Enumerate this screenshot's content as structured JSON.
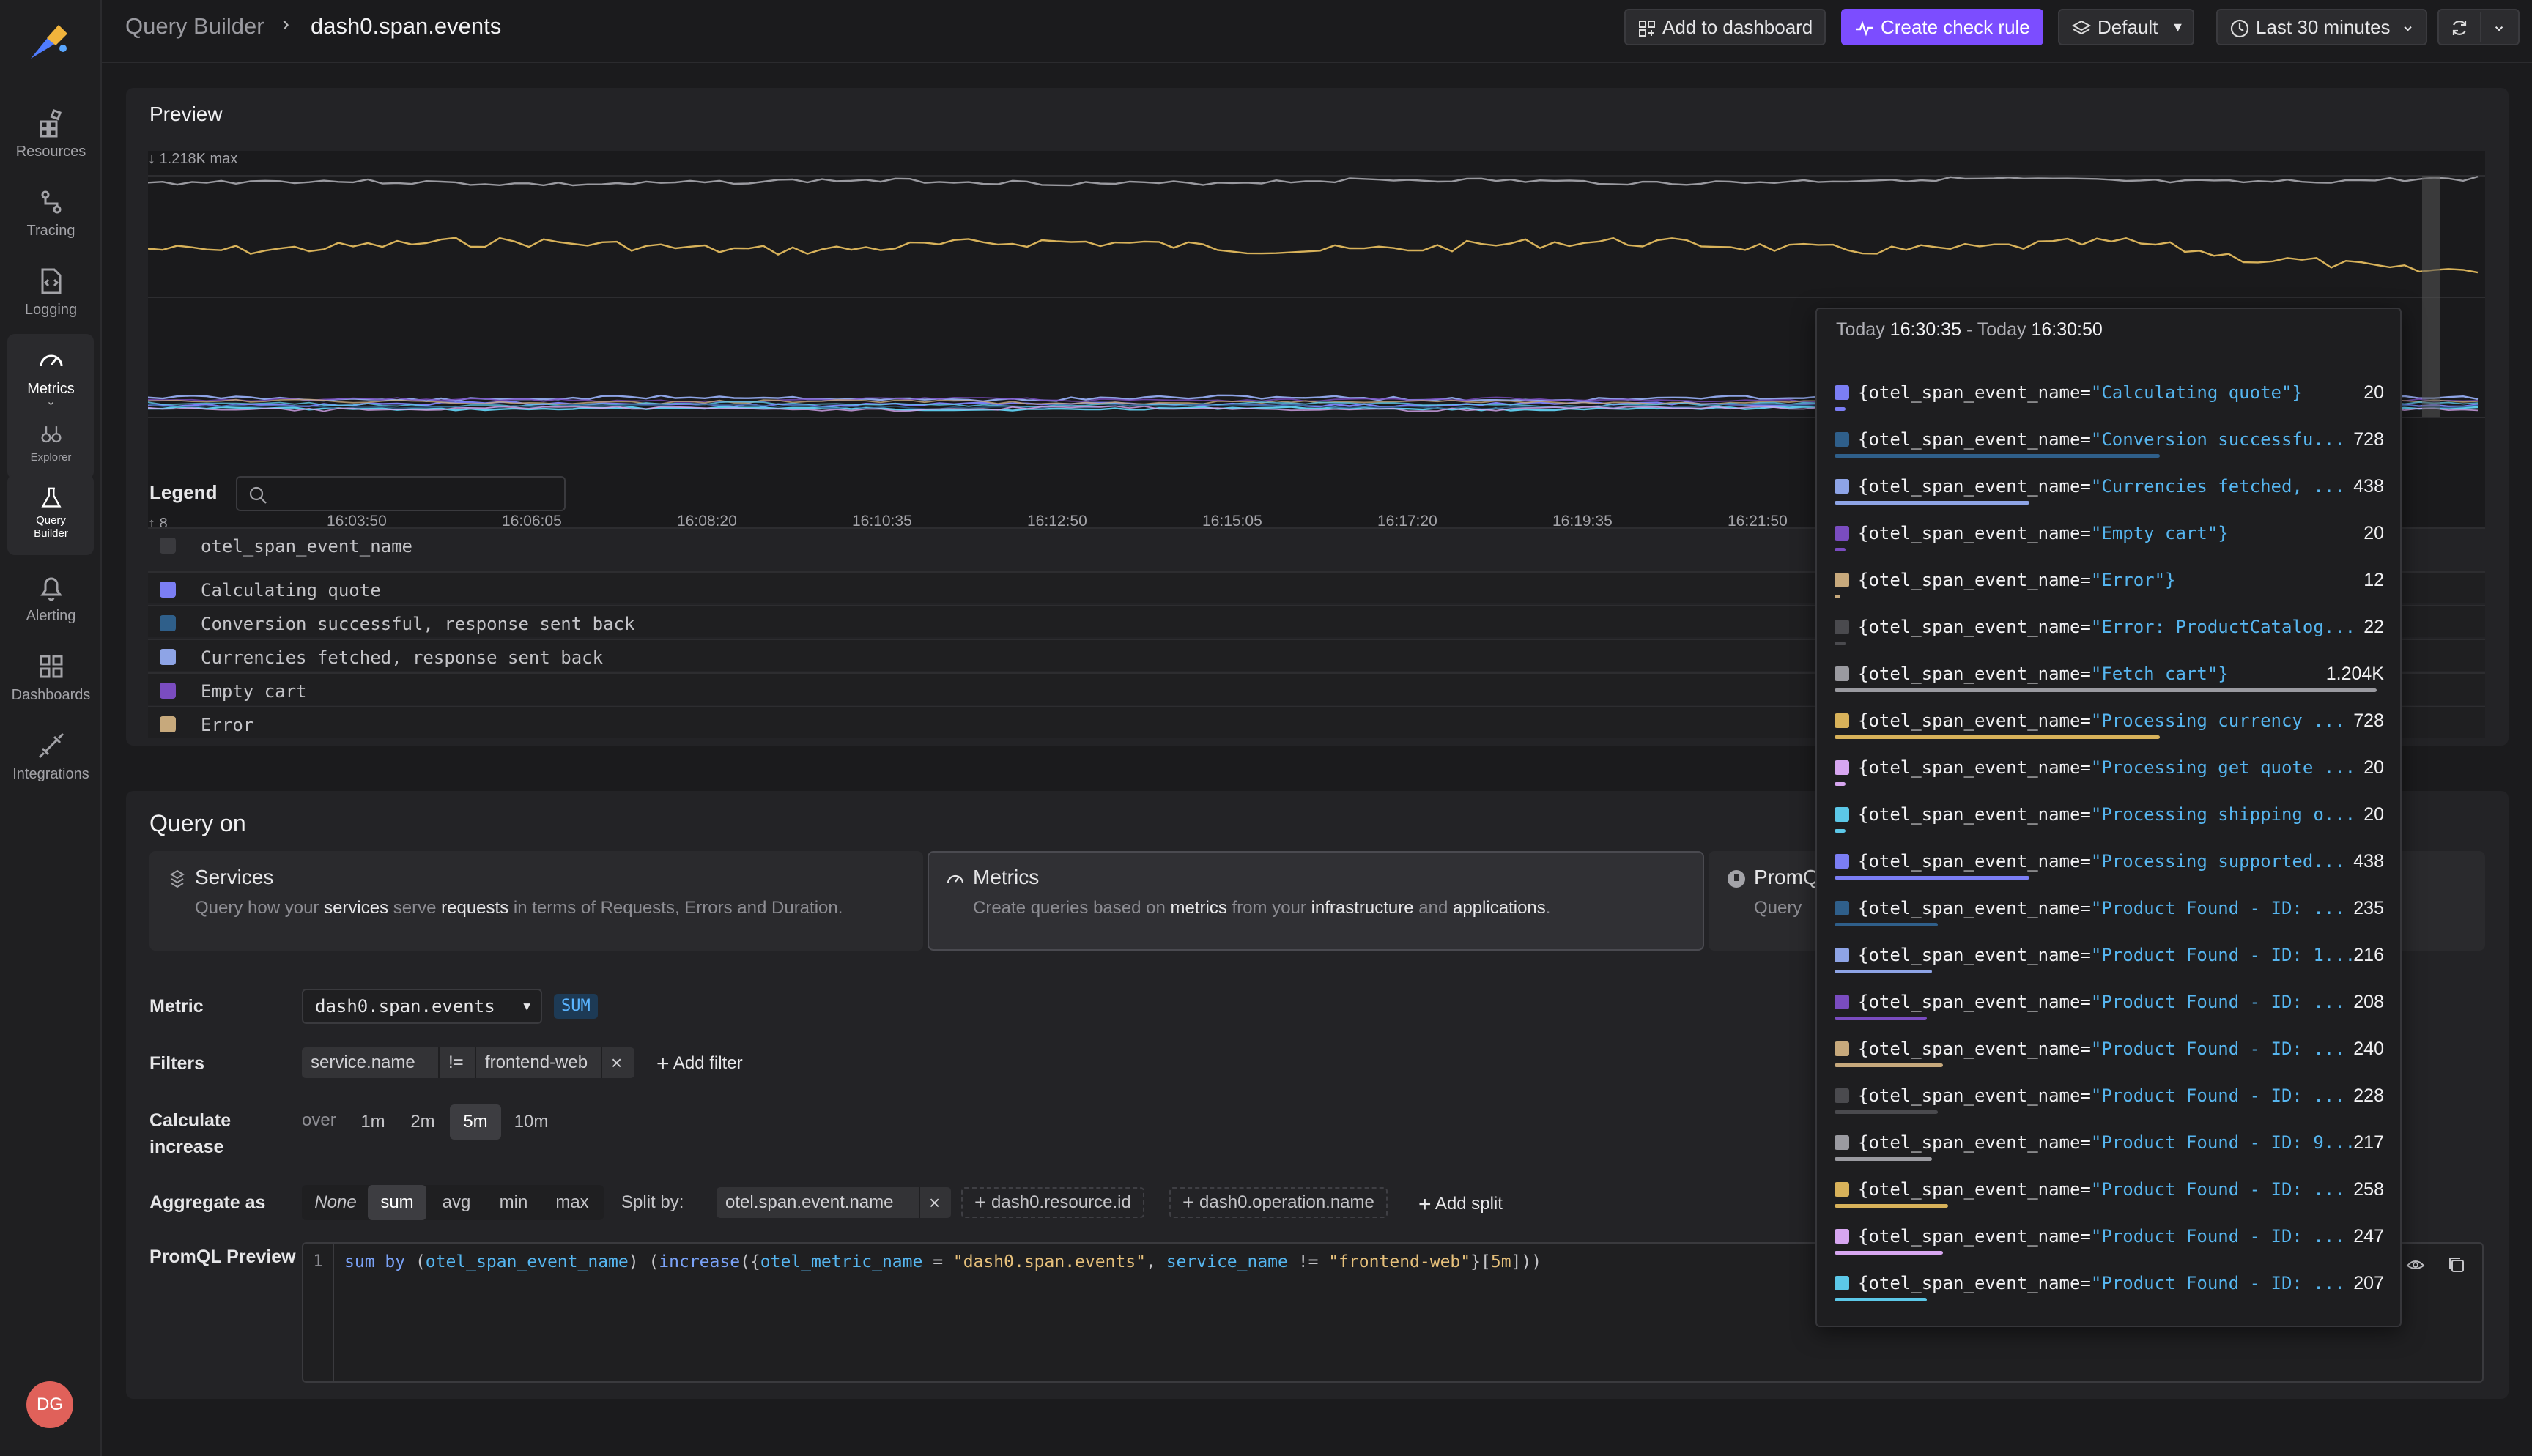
{
  "sidebar": {
    "items": [
      {
        "label": "Resources",
        "icon": "resources-icon"
      },
      {
        "label": "Tracing",
        "icon": "tracing-icon"
      },
      {
        "label": "Logging",
        "icon": "logging-icon"
      },
      {
        "label": "Metrics",
        "icon": "metrics-icon"
      },
      {
        "label": "Explorer",
        "icon": "explorer-icon"
      },
      {
        "label": "Query Builder",
        "icon": "query-builder-icon"
      },
      {
        "label": "Alerting",
        "icon": "alerting-icon"
      },
      {
        "label": "Dashboards",
        "icon": "dashboards-icon"
      },
      {
        "label": "Integrations",
        "icon": "integrations-icon"
      }
    ],
    "avatar_initials": "DG"
  },
  "header": {
    "breadcrumb_root": "Query Builder",
    "breadcrumb_separator": "›",
    "breadcrumb_current": "dash0.span.events",
    "add_to_dashboard": "Add to dashboard",
    "create_check_rule": "Create check rule",
    "dataset": "Default",
    "time_range": "Last 30 minutes"
  },
  "preview": {
    "title": "Preview",
    "y_max_note": "↓ 1.218K max",
    "y_min_note": "↑ 8",
    "x_ticks": [
      "16:03:50",
      "16:06:05",
      "16:08:20",
      "16:10:35",
      "16:12:50",
      "16:15:05",
      "16:17:20",
      "16:19:35",
      "16:21:50"
    ],
    "legend_title": "Legend",
    "legend_header": "otel_span_event_name",
    "legend_items": [
      {
        "label": "Calculating quote",
        "color": "#7b7ef4"
      },
      {
        "label": "Conversion successful, response sent back",
        "color": "#2f5f8a"
      },
      {
        "label": "Currencies fetched, response sent back",
        "color": "#8ea4e6"
      },
      {
        "label": "Empty cart",
        "color": "#7a4cc0"
      },
      {
        "label": "Error",
        "color": "#c7a97c"
      }
    ]
  },
  "chart_data": {
    "type": "line",
    "y_max": 1218,
    "y_min": 8,
    "x_ticks": [
      "16:03:50",
      "16:06:05",
      "16:08:20",
      "16:10:35",
      "16:12:50",
      "16:15:05",
      "16:17:20",
      "16:19:35",
      "16:21:50"
    ],
    "series": [
      {
        "name": "Fetch cart",
        "color": "#9a9aa0"
      },
      {
        "name": "Processing currency",
        "color": "#d8b25a"
      },
      {
        "name": "Currencies fetched",
        "color": "#8ea4e6"
      },
      {
        "name": "Calculating quote",
        "color": "#7b7ef4"
      },
      {
        "name": "Processing shipping",
        "color": "#5cc8e8"
      }
    ]
  },
  "query": {
    "title": "Query on",
    "cards": [
      {
        "title": "Services",
        "desc_parts": [
          "Query how your ",
          "services",
          " serve ",
          "requests",
          " in terms of Requests, Errors and Duration."
        ]
      },
      {
        "title": "Metrics",
        "desc_parts": [
          "Create queries based on ",
          "metrics",
          " from your ",
          "infrastructure",
          " and ",
          "applications",
          "."
        ]
      },
      {
        "title": "PromQL",
        "desc_parts": [
          "Query"
        ]
      }
    ],
    "metric_label": "Metric",
    "metric_value": "dash0.span.events",
    "metric_badge": "SUM",
    "filters_label": "Filters",
    "filter": {
      "key": "service.name",
      "op": "!=",
      "value": "frontend-web"
    },
    "add_filter": "Add filter",
    "calc_label_1": "Calculate",
    "calc_label_2": "increase",
    "over": "over",
    "windows": [
      "1m",
      "2m",
      "5m",
      "10m"
    ],
    "window_selected": "5m",
    "aggregate_label": "Aggregate as",
    "aggregations": [
      "None",
      "sum",
      "avg",
      "min",
      "max"
    ],
    "aggregation_selected": "sum",
    "split_by_label": "Split by:",
    "split_active": "otel.span.event.name",
    "split_options": [
      "dash0.resource.id",
      "dash0.operation.name"
    ],
    "add_split": "Add split",
    "promql_label": "PromQL Preview",
    "promql_line_no": "1"
  },
  "tooltip": {
    "range_prefix": "Today ",
    "range_start": "16:30:35",
    "range_mid": " - Today ",
    "range_end": "16:30:50",
    "key": "{otel_span_event_name=",
    "rows": [
      {
        "label": "\"Calculating quote\"}",
        "value": "20",
        "color": "#7b7ef4",
        "frac": 0.02
      },
      {
        "label": "\"Conversion successfu...",
        "value": "728",
        "color": "#2f5f8a",
        "frac": 0.6
      },
      {
        "label": "\"Currencies fetched, ...",
        "value": "438",
        "color": "#8ea4e6",
        "frac": 0.36
      },
      {
        "label": "\"Empty cart\"}",
        "value": "20",
        "color": "#7a4cc0",
        "frac": 0.02
      },
      {
        "label": "\"Error\"}",
        "value": "12",
        "color": "#c7a97c",
        "frac": 0.01
      },
      {
        "label": "\"Error: ProductCatalog...",
        "value": "22",
        "color": "#4a4a4e",
        "frac": 0.02
      },
      {
        "label": "\"Fetch cart\"}",
        "value": "1.204K",
        "color": "#9a9aa0",
        "frac": 1.0
      },
      {
        "label": "\"Processing currency ...",
        "value": "728",
        "color": "#d8b25a",
        "frac": 0.6
      },
      {
        "label": "\"Processing get quote ...",
        "value": "20",
        "color": "#d7a6f0",
        "frac": 0.02
      },
      {
        "label": "\"Processing shipping o...",
        "value": "20",
        "color": "#5cc8e8",
        "frac": 0.02
      },
      {
        "label": "\"Processing supported...",
        "value": "438",
        "color": "#7b7ef4",
        "frac": 0.36
      },
      {
        "label": "\"Product Found - ID: ...",
        "value": "235",
        "color": "#2f5f8a",
        "frac": 0.19
      },
      {
        "label": "\"Product Found - ID: 1...",
        "value": "216",
        "color": "#8ea4e6",
        "frac": 0.18
      },
      {
        "label": "\"Product Found - ID: ...",
        "value": "208",
        "color": "#7a4cc0",
        "frac": 0.17
      },
      {
        "label": "\"Product Found - ID: ...",
        "value": "240",
        "color": "#c7a97c",
        "frac": 0.2
      },
      {
        "label": "\"Product Found - ID: ...",
        "value": "228",
        "color": "#4a4a4e",
        "frac": 0.19
      },
      {
        "label": "\"Product Found - ID: 9...",
        "value": "217",
        "color": "#9a9aa0",
        "frac": 0.18
      },
      {
        "label": "\"Product Found - ID: ...",
        "value": "258",
        "color": "#d8b25a",
        "frac": 0.21
      },
      {
        "label": "\"Product Found - ID: ...",
        "value": "247",
        "color": "#d7a6f0",
        "frac": 0.2
      },
      {
        "label": "\"Product Found - ID: ...",
        "value": "207",
        "color": "#5cc8e8",
        "frac": 0.17
      }
    ]
  }
}
